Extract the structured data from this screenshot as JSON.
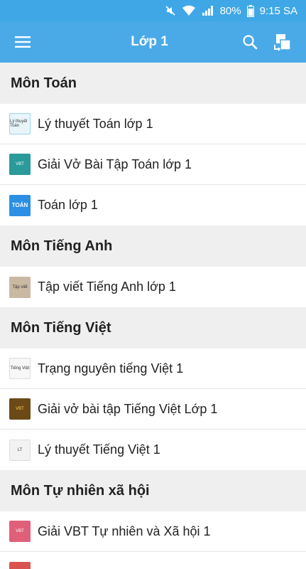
{
  "status_bar": {
    "battery": "80%",
    "time": "9:15 SA",
    "icons": [
      "mute-icon",
      "wifi-icon",
      "signal-icon",
      "battery-icon"
    ]
  },
  "app_bar": {
    "title": "Lớp 1",
    "icons": [
      "menu-icon",
      "search-icon",
      "share-icon"
    ]
  },
  "sections": [
    {
      "title": "Môn Toán",
      "items": [
        {
          "label": "Lý thuyết Toán lớp 1",
          "thumb_text": "Lý thuyết Toán"
        },
        {
          "label": "Giải Vở Bài Tập Toán lớp 1",
          "thumb_text": "VBT"
        },
        {
          "label": "Toán lớp 1",
          "thumb_text": "TOÁN"
        }
      ]
    },
    {
      "title": "Môn Tiếng Anh",
      "items": [
        {
          "label": "Tập viết Tiếng Anh lớp 1",
          "thumb_text": "Tập viết"
        }
      ]
    },
    {
      "title": "Môn Tiếng Việt",
      "items": [
        {
          "label": "Trạng nguyên tiếng Việt 1",
          "thumb_text": "Tiếng Việt"
        },
        {
          "label": "Giải vở bài tập Tiếng Việt Lớp 1",
          "thumb_text": "VBT"
        },
        {
          "label": "Lý thuyết Tiếng Việt 1",
          "thumb_text": "LT"
        }
      ]
    },
    {
      "title": "Môn Tự nhiên xã hội",
      "items": [
        {
          "label": "Giải VBT Tự nhiên và Xã hội 1",
          "thumb_text": "VBT"
        },
        {
          "label": "",
          "thumb_text": ""
        }
      ]
    }
  ],
  "colors": {
    "primary": "#4aaae8",
    "status_bar": "#3fa7e6",
    "background": "#efefef"
  }
}
